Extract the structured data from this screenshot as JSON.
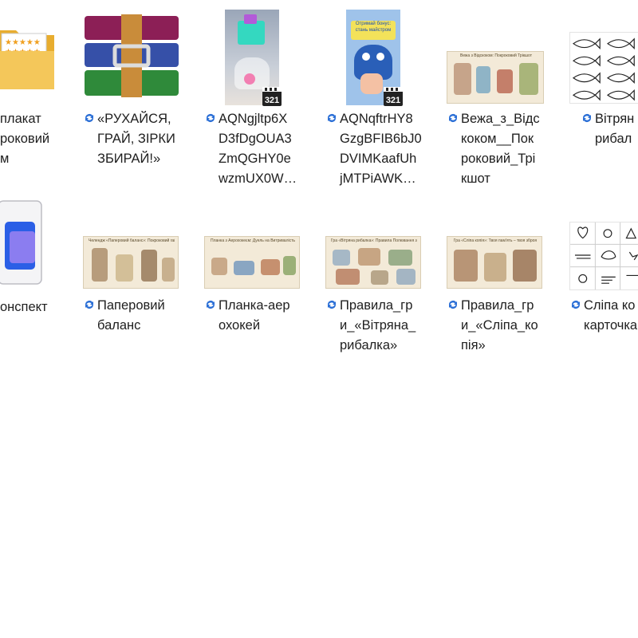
{
  "files": [
    {
      "id": "plakat",
      "label": "плакат\nроковий\nм",
      "type": "folder"
    },
    {
      "id": "rukhaisya",
      "label": "«РУХАЙСЯ,\nГРАЙ, ЗІРКИ\nЗБИРАЙ!»",
      "type": "archive",
      "sync": true
    },
    {
      "id": "video1",
      "label": "AQNgjltp6X\nD3fDgOUA3\nZmQGHY0e\nwzmUX0W…",
      "type": "video",
      "sync": true
    },
    {
      "id": "video2",
      "label": "AQNqftrHY8\nGzgBFIB6bJ0\nDVIMKaafUh\njMTPiAWK…",
      "type": "video",
      "sync": true
    },
    {
      "id": "vezha",
      "label": "Вежа_з_Відс\nкоком__Пок\nроковий_Трі\nкшот",
      "type": "image",
      "sync": true
    },
    {
      "id": "vitryana1",
      "label": "Вітрян\nрибал",
      "type": "image",
      "sync": true
    },
    {
      "id": "konspekt",
      "label": "онспект",
      "type": "app"
    },
    {
      "id": "paperovyi",
      "label": "Паперовий\nбаланс",
      "type": "image",
      "sync": true
    },
    {
      "id": "planka",
      "label": "Планка-аер\nохокей",
      "type": "image",
      "sync": true
    },
    {
      "id": "pravyla1",
      "label": "Правила_гр\nи_«Вітряна_\nрибалка»",
      "type": "image",
      "sync": true
    },
    {
      "id": "pravyla2",
      "label": "Правила_гр\nи_«Сліпа_ко\nпія»",
      "type": "image",
      "sync": true
    },
    {
      "id": "slipa",
      "label": "Сліпа ко\nкарточка",
      "type": "image",
      "sync": true
    }
  ],
  "thumb_text": {
    "vezha_title": "Вежа з Відскоком: Покроковий Трікшот",
    "planka_title": "Планка з Аерохокеєм: Дуель на Витривалість",
    "pravyla1_title": "Гра «Вітряна рибалка»: Правила Полювання за Зіркою",
    "pravyla2_title": "Гра «Сліпа копія»: Твоя пам'ять – твоя зброя",
    "paper_title": "Челендж «Паперовий баланс»: Покроковий гайд",
    "video_badge": "321",
    "video2_banner": "Отримай бонус: стань майстром"
  },
  "colors": {
    "sync": "#2b6fd6",
    "folder": "#f2c04c",
    "parchment": "#f3ead8"
  }
}
